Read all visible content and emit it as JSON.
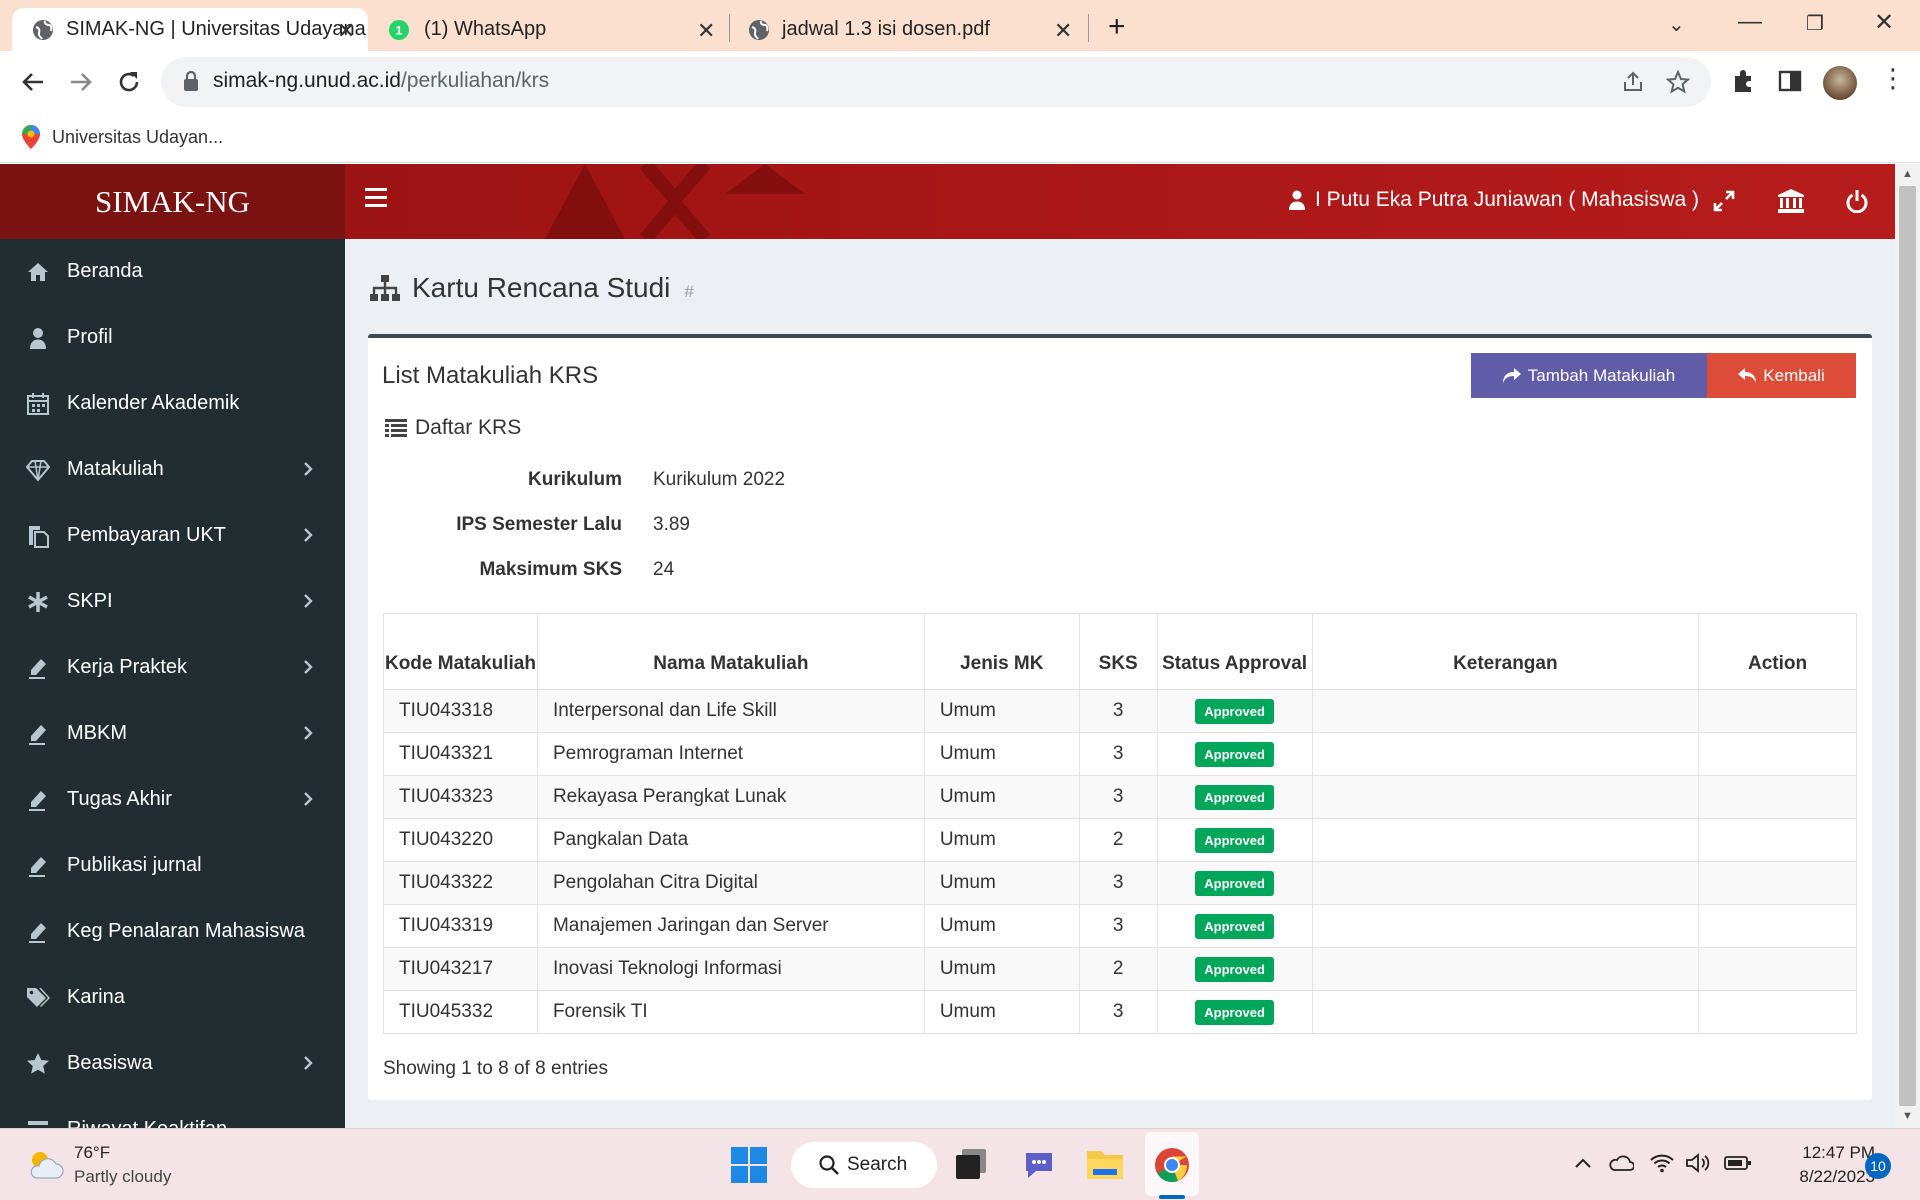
{
  "browser": {
    "tabs": [
      {
        "title": "SIMAK-NG | Universitas Udayana",
        "icon": "globe-icon",
        "active": true
      },
      {
        "title": "(1) WhatsApp",
        "icon": "whatsapp-icon",
        "active": false
      },
      {
        "title": "jadwal 1.3 isi dosen.pdf",
        "icon": "globe-icon",
        "active": false
      }
    ],
    "url_host": "simak-ng.unud.ac.id",
    "url_path": "/perkuliahan/krs",
    "bookmark": "Universitas Udayan..."
  },
  "app": {
    "brand": "SIMAK-NG",
    "user": "I Putu Eka Putra Juniawan ( Mahasiswa )",
    "header_bg": "#9c1313"
  },
  "sidebar": {
    "items": [
      {
        "label": "Beranda",
        "icon": "home-icon",
        "has_sub": false
      },
      {
        "label": "Profil",
        "icon": "user-icon",
        "has_sub": false
      },
      {
        "label": "Kalender Akademik",
        "icon": "calendar-icon",
        "has_sub": false
      },
      {
        "label": "Matakuliah",
        "icon": "diamond-icon",
        "has_sub": true
      },
      {
        "label": "Pembayaran UKT",
        "icon": "copy-icon",
        "has_sub": true
      },
      {
        "label": "SKPI",
        "icon": "asterisk-icon",
        "has_sub": true
      },
      {
        "label": "Kerja Praktek",
        "icon": "pencil-icon",
        "has_sub": true
      },
      {
        "label": "MBKM",
        "icon": "pencil-icon",
        "has_sub": true
      },
      {
        "label": "Tugas Akhir",
        "icon": "pencil-icon",
        "has_sub": true
      },
      {
        "label": "Publikasi jurnal",
        "icon": "pencil-icon",
        "has_sub": false
      },
      {
        "label": "Keg Penalaran Mahasiswa",
        "icon": "pencil-icon",
        "has_sub": false
      },
      {
        "label": "Karina",
        "icon": "tags-icon",
        "has_sub": false
      },
      {
        "label": "Beasiswa",
        "icon": "star-icon",
        "has_sub": true
      },
      {
        "label": "Riwayat Keaktifan",
        "icon": "list-icon",
        "has_sub": false
      }
    ]
  },
  "page": {
    "title": "Kartu Rencana Studi",
    "hash": "#",
    "box_title": "List Matakuliah KRS",
    "btn_tambah": "Tambah Matakuliah",
    "btn_kembali": "Kembali",
    "section": "Daftar KRS",
    "info": [
      {
        "key": "Kurikulum",
        "value": "Kurikulum 2022"
      },
      {
        "key": "IPS Semester Lalu",
        "value": "3.89"
      },
      {
        "key": "Maksimum SKS",
        "value": "24"
      }
    ],
    "table": {
      "headers": [
        "Kode Matakuliah",
        "Nama Matakuliah",
        "Jenis MK",
        "SKS",
        "Status Approval",
        "Keterangan",
        "Action"
      ],
      "rows": [
        {
          "kode": "TIU043318",
          "nama": "Interpersonal dan Life Skill",
          "jenis": "Umum",
          "sks": "3",
          "status": "Approved",
          "ket": "",
          "action": ""
        },
        {
          "kode": "TIU043321",
          "nama": "Pemrograman Internet",
          "jenis": "Umum",
          "sks": "3",
          "status": "Approved",
          "ket": "",
          "action": ""
        },
        {
          "kode": "TIU043323",
          "nama": "Rekayasa Perangkat Lunak",
          "jenis": "Umum",
          "sks": "3",
          "status": "Approved",
          "ket": "",
          "action": ""
        },
        {
          "kode": "TIU043220",
          "nama": "Pangkalan Data",
          "jenis": "Umum",
          "sks": "2",
          "status": "Approved",
          "ket": "",
          "action": ""
        },
        {
          "kode": "TIU043322",
          "nama": "Pengolahan Citra Digital",
          "jenis": "Umum",
          "sks": "3",
          "status": "Approved",
          "ket": "",
          "action": ""
        },
        {
          "kode": "TIU043319",
          "nama": "Manajemen Jaringan dan Server",
          "jenis": "Umum",
          "sks": "3",
          "status": "Approved",
          "ket": "",
          "action": ""
        },
        {
          "kode": "TIU043217",
          "nama": "Inovasi Teknologi Informasi",
          "jenis": "Umum",
          "sks": "2",
          "status": "Approved",
          "ket": "",
          "action": ""
        },
        {
          "kode": "TIU045332",
          "nama": "Forensik TI",
          "jenis": "Umum",
          "sks": "3",
          "status": "Approved",
          "ket": "",
          "action": ""
        }
      ]
    },
    "showing": "Showing 1 to 8 of 8 entries"
  },
  "taskbar": {
    "temp": "76°F",
    "weather": "Partly cloudy",
    "search": "Search",
    "time": "12:47 PM",
    "date": "8/22/2023",
    "notifications": "10"
  }
}
